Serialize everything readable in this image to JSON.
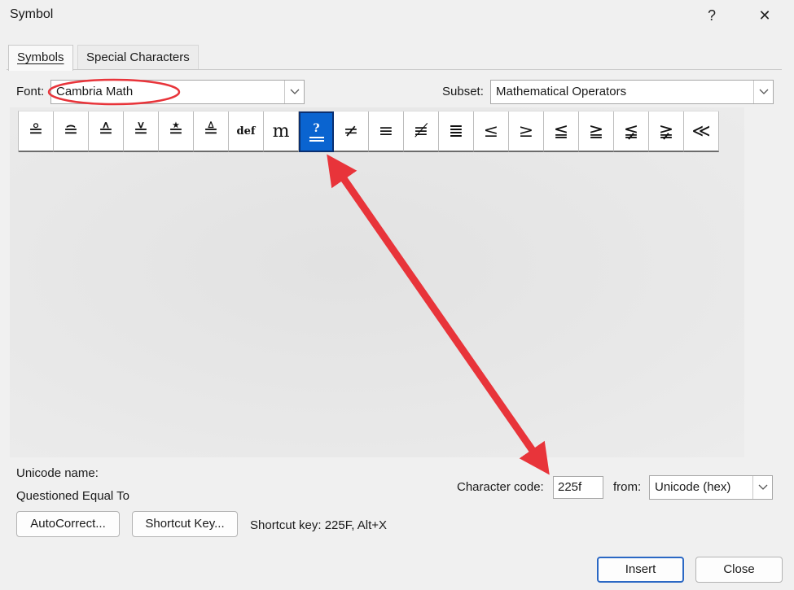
{
  "window": {
    "title": "Symbol",
    "help_label": "?",
    "close_label": "✕"
  },
  "tabs": [
    {
      "label": "Symbols",
      "active": true
    },
    {
      "label": "Special Characters",
      "active": false
    }
  ],
  "font": {
    "label": "Font:",
    "value": "Cambria Math"
  },
  "subset": {
    "label": "Subset:",
    "value": "Mathematical Operators"
  },
  "symbols": [
    "≗",
    "≘",
    "≙",
    "≚",
    "≛",
    "≜",
    "def",
    "m",
    "?",
    "≠",
    "≡",
    "≢",
    "≣",
    "≤",
    "≥",
    "≦",
    "≧",
    "≨",
    "≩",
    "≪"
  ],
  "selected_index": 8,
  "unicode": {
    "name_label": "Unicode name:",
    "name_value": "Questioned Equal To"
  },
  "character_code": {
    "label": "Character code:",
    "value": "225f",
    "from_label": "from:",
    "from_value": "Unicode (hex)"
  },
  "buttons": {
    "autocorrect": "AutoCorrect...",
    "shortcut_key": "Shortcut Key...",
    "insert": "Insert",
    "close": "Close"
  },
  "shortcut_text": "Shortcut key: 225F, Alt+X",
  "colors": {
    "selection": "#0a64d0",
    "annotation_red": "#e8343a",
    "primary_border": "#2b68c4"
  }
}
